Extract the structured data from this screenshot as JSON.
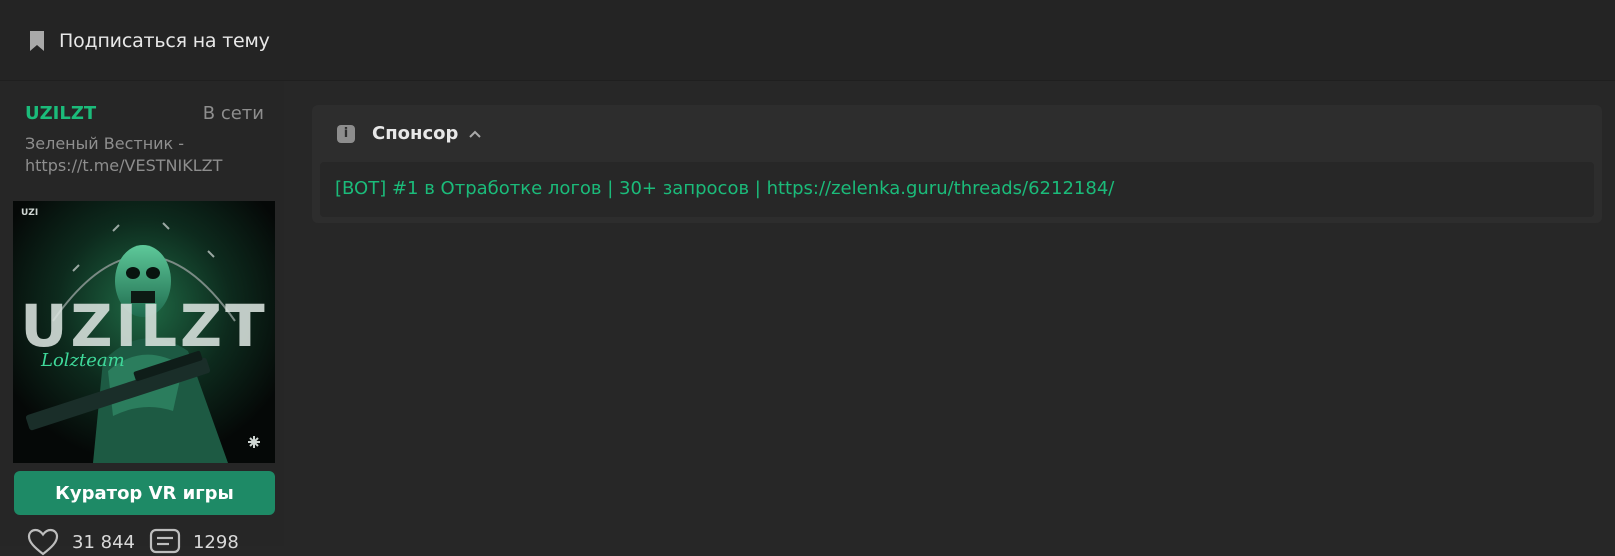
{
  "topbar": {
    "subscribe_label": "Подписаться на тему",
    "subscribe_icon": "bookmark-icon"
  },
  "profile": {
    "username": "UZILZT",
    "online_status": "В сети",
    "status_line1": "Зеленый Вестник -",
    "status_line2": "https://t.me/VESTNIKLZT",
    "avatar_text": "UZILZT",
    "avatar_corner": "UZI",
    "avatar_script": "Lolzteam",
    "role_button": "Куратор VR игры",
    "likes_count": "31 844",
    "messages_count": "1298",
    "likes_icon": "heart-icon",
    "messages_icon": "message-icon"
  },
  "sponsor": {
    "title": "Спонсор",
    "link_text": "[BOT] #1 в Отработке логов | 30+ запросов | https://zelenka.guru/threads/6212184/"
  },
  "colors": {
    "accent": "#1bbb7a",
    "button": "#1e8a66",
    "background": "#272727"
  }
}
